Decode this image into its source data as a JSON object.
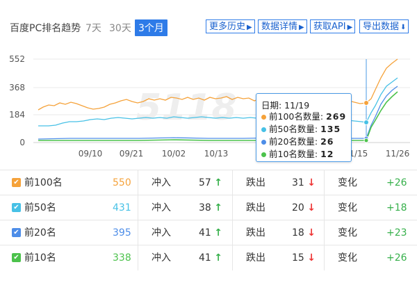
{
  "header": {
    "title": "百度PC排名趋势",
    "ranges": [
      "7天",
      "30天",
      "3个月"
    ],
    "active_range": "3个月",
    "buttons": {
      "history": "更多历史",
      "details": "数据详情",
      "api": "获取API",
      "export": "导出数据"
    }
  },
  "chart_data": {
    "type": "line",
    "y_ticks": [
      "552",
      "368",
      "184",
      "0"
    ],
    "ylim": [
      0,
      552
    ],
    "x_ticks": [
      "09/10",
      "09/21",
      "10/02",
      "10/13",
      "11/15",
      "11/26"
    ],
    "watermark": "5118",
    "series": [
      {
        "name": "前100名",
        "color": "#f5a23a"
      },
      {
        "name": "前50名",
        "color": "#47c1e6"
      },
      {
        "name": "前20名",
        "color": "#4d8de8"
      },
      {
        "name": "前10名",
        "color": "#4cc24c"
      }
    ],
    "tooltip": {
      "date_label": "日期: 11/19",
      "rows": [
        {
          "label": "前100名数量:",
          "value": "269",
          "color": "#f5a23a"
        },
        {
          "label": "前50名数量:",
          "value": "135",
          "color": "#47c1e6"
        },
        {
          "label": "前20名数量:",
          "value": "26",
          "color": "#4d8de8"
        },
        {
          "label": "前10名数量:",
          "value": "12",
          "color": "#4cc24c"
        }
      ]
    }
  },
  "table": {
    "rows": [
      {
        "name": "前100名",
        "count": "550",
        "count_color": "#f5a23a",
        "cb_color": "#f5a23a",
        "in_label": "冲入",
        "in_value": "57",
        "out_label": "跌出",
        "out_value": "31",
        "change_label": "变化",
        "change_value": "+26"
      },
      {
        "name": "前50名",
        "count": "431",
        "count_color": "#47c1e6",
        "cb_color": "#47c1e6",
        "in_label": "冲入",
        "in_value": "38",
        "out_label": "跌出",
        "out_value": "20",
        "change_label": "变化",
        "change_value": "+18"
      },
      {
        "name": "前20名",
        "count": "395",
        "count_color": "#4d8de8",
        "cb_color": "#4d8de8",
        "in_label": "冲入",
        "in_value": "41",
        "out_label": "跌出",
        "out_value": "18",
        "change_label": "变化",
        "change_value": "+23"
      },
      {
        "name": "前10名",
        "count": "338",
        "count_color": "#4cc24c",
        "cb_color": "#4cc24c",
        "in_label": "冲入",
        "in_value": "41",
        "out_label": "跌出",
        "out_value": "15",
        "change_label": "变化",
        "change_value": "+26"
      }
    ]
  }
}
